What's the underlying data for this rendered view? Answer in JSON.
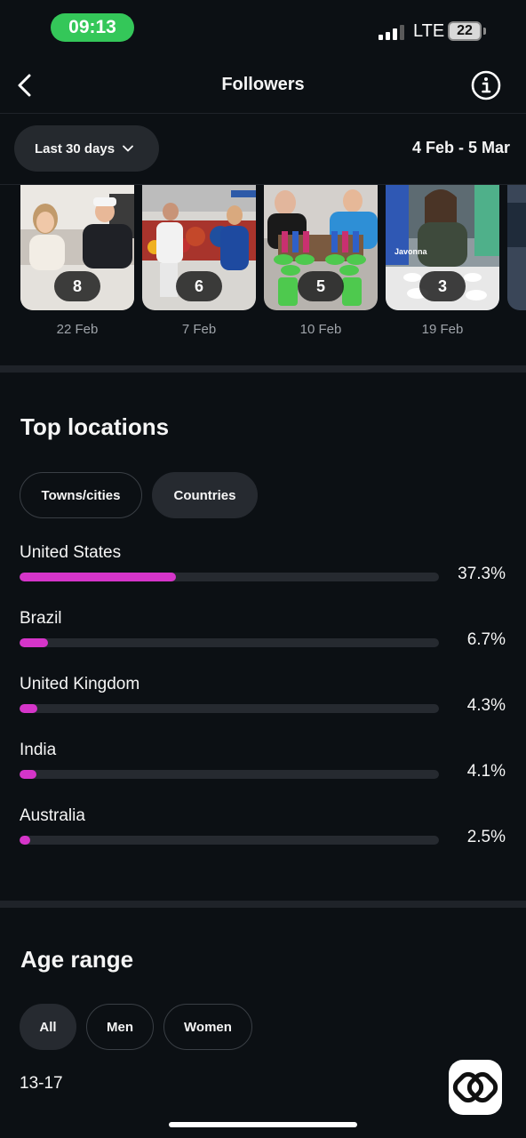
{
  "status_bar": {
    "time": "09:13",
    "network": "LTE",
    "battery": "22"
  },
  "header": {
    "title": "Followers"
  },
  "filter": {
    "range_label": "Last 30 days",
    "date_range": "4 Feb - 5 Mar"
  },
  "posts": [
    {
      "count": "8",
      "date": "22 Feb"
    },
    {
      "count": "6",
      "date": "7 Feb"
    },
    {
      "count": "5",
      "date": "10 Feb"
    },
    {
      "count": "3",
      "date": "19 Feb",
      "overlay_text": "Javonna"
    }
  ],
  "top_locations": {
    "title": "Top locations",
    "tabs": [
      {
        "label": "Towns/cities",
        "active": false
      },
      {
        "label": "Countries",
        "active": true
      }
    ],
    "items": [
      {
        "name": "United States",
        "percent_label": "37.3%",
        "value": 37.3
      },
      {
        "name": "Brazil",
        "percent_label": "6.7%",
        "value": 6.7
      },
      {
        "name": "United Kingdom",
        "percent_label": "4.3%",
        "value": 4.3
      },
      {
        "name": "India",
        "percent_label": "4.1%",
        "value": 4.1
      },
      {
        "name": "Australia",
        "percent_label": "2.5%",
        "value": 2.5
      }
    ],
    "bar_color": "#d535c9"
  },
  "age_range": {
    "title": "Age range",
    "tabs": [
      {
        "label": "All",
        "active": true
      },
      {
        "label": "Men",
        "active": false
      },
      {
        "label": "Women",
        "active": false
      }
    ],
    "first_bucket": "13-17"
  }
}
